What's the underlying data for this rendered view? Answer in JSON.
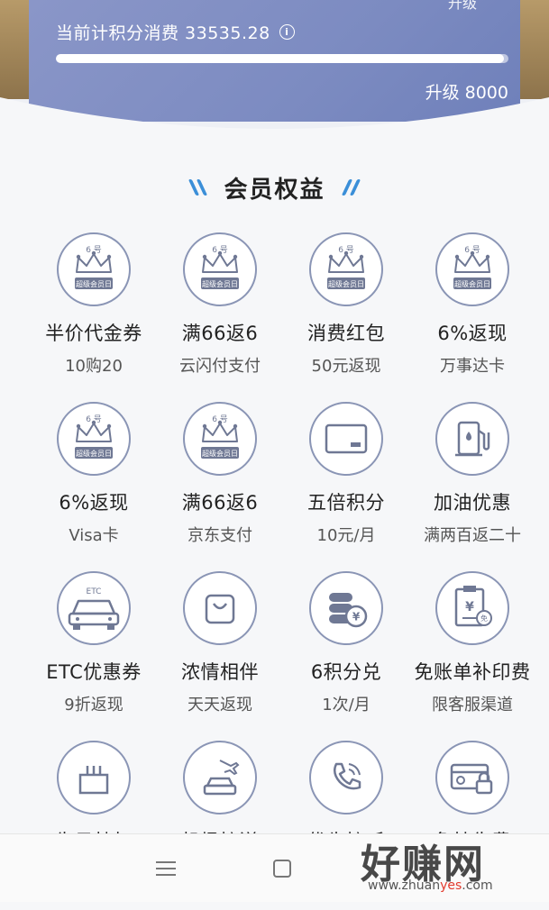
{
  "card": {
    "top_cut_text": "升级",
    "consume_label": "当前计积分消费 33535.28",
    "info_icon": "i",
    "progress": 0.99,
    "upgrade_label": "升级 8000"
  },
  "section": {
    "title": "会员权益"
  },
  "stamp": {
    "top_text": "6 号",
    "bottom_text": "超级会员日"
  },
  "benefits": [
    {
      "icon": "super-member-day-stamp-icon",
      "title": "半价代金券",
      "sub": "10购20"
    },
    {
      "icon": "super-member-day-stamp-icon",
      "title": "满66返6",
      "sub": "云闪付支付"
    },
    {
      "icon": "super-member-day-stamp-icon",
      "title": "消费红包",
      "sub": "50元返现"
    },
    {
      "icon": "super-member-day-stamp-icon",
      "title": "6%返现",
      "sub": "万事达卡"
    },
    {
      "icon": "super-member-day-stamp-icon",
      "title": "6%返现",
      "sub": "Visa卡"
    },
    {
      "icon": "super-member-day-stamp-icon",
      "title": "满66返6",
      "sub": "京东支付"
    },
    {
      "icon": "credit-card-icon",
      "title": "五倍积分",
      "sub": "10元/月"
    },
    {
      "icon": "gas-pump-icon",
      "title": "加油优惠",
      "sub": "满两百返二十"
    },
    {
      "icon": "etc-car-icon",
      "title": "ETC优惠券",
      "sub": "9折返现"
    },
    {
      "icon": "shopping-bag-icon",
      "title": "浓情相伴",
      "sub": "天天返现"
    },
    {
      "icon": "coins-exchange-icon",
      "title": "6积分兑",
      "sub": "1次/月"
    },
    {
      "icon": "statement-reprint-icon",
      "title": "免账单补印费",
      "sub": "限客服渠道"
    },
    {
      "icon": "birthday-cake-icon",
      "title": "生日特权",
      "sub": ""
    },
    {
      "icon": "airport-transfer-icon",
      "title": "机场接送",
      "sub": ""
    },
    {
      "icon": "priority-phone-icon",
      "title": "优先接听",
      "sub": ""
    },
    {
      "icon": "card-lock-icon",
      "title": "免挂失费",
      "sub": ""
    }
  ],
  "etc_text": "ETC",
  "watermark": {
    "main": "好赚网",
    "url_prefix": "www.zhuan",
    "url_highlight": "yes",
    "url_suffix": ".com"
  }
}
